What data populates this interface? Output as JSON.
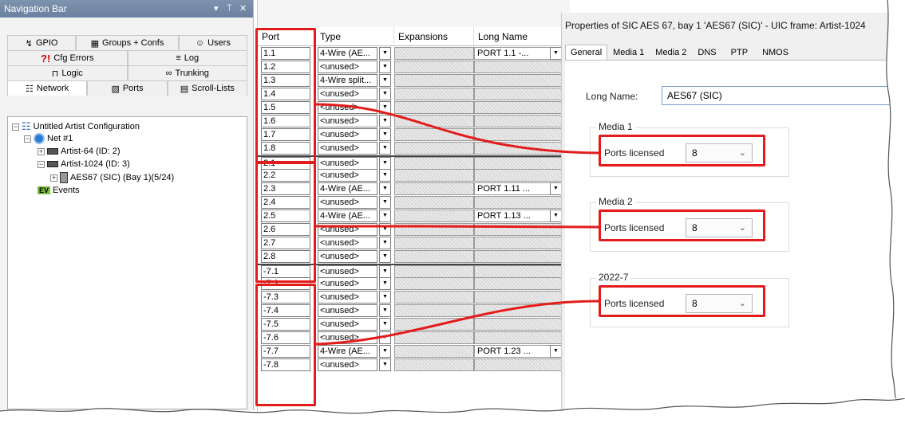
{
  "nav": {
    "title": "Navigation Bar",
    "controls": [
      "▾",
      "⍑",
      "✕"
    ],
    "tabs_row1": [
      {
        "label": "GPIO",
        "icon": "gpio-icon"
      },
      {
        "label": "Groups + Confs",
        "icon": "groups-icon"
      },
      {
        "label": "Users",
        "icon": "users-icon"
      }
    ],
    "tabs_row2": [
      {
        "label": "Cfg Errors",
        "icon": "error-icon"
      },
      {
        "label": "Log",
        "icon": "log-icon"
      }
    ],
    "tabs_row3": [
      {
        "label": "Logic",
        "icon": "logic-icon"
      },
      {
        "label": "Trunking",
        "icon": "trunking-icon"
      }
    ],
    "tabs_row4": [
      {
        "label": "Network",
        "icon": "network-icon"
      },
      {
        "label": "Ports",
        "icon": "ports-icon"
      },
      {
        "label": "Scroll-Lists",
        "icon": "scroll-lists-icon"
      }
    ],
    "tree": {
      "root": "Untitled Artist Configuration",
      "net": "Net #1",
      "node1": "Artist-64 (ID: 2)",
      "node2": "Artist-1024 (ID: 3)",
      "card": "AES67 (SIC) (Bay  1)(5/24)",
      "events": "Events",
      "events_badge": "EV"
    }
  },
  "grid": {
    "headers": [
      "Port",
      "Type",
      "Expansions",
      "Long Name"
    ],
    "rows": [
      {
        "port": "1.1",
        "type": "4-Wire (AE...",
        "long_name": "PORT 1.1 -..."
      },
      {
        "port": "1.2",
        "type": "<unused>",
        "long_name": ""
      },
      {
        "port": "1.3",
        "type": "4-Wire split...",
        "long_name": ""
      },
      {
        "port": "1.4",
        "type": "<unused>",
        "long_name": ""
      },
      {
        "port": "1.5",
        "type": "<unused>",
        "long_name": ""
      },
      {
        "port": "1.6",
        "type": "<unused>",
        "long_name": ""
      },
      {
        "port": "1.7",
        "type": "<unused>",
        "long_name": ""
      },
      {
        "port": "1.8",
        "type": "<unused>",
        "long_name": ""
      },
      {
        "port": "2.1",
        "type": "<unused>",
        "long_name": ""
      },
      {
        "port": "2.2",
        "type": "<unused>",
        "long_name": ""
      },
      {
        "port": "2.3",
        "type": "4-Wire (AE...",
        "long_name": "PORT 1.11 ..."
      },
      {
        "port": "2.4",
        "type": "<unused>",
        "long_name": ""
      },
      {
        "port": "2.5",
        "type": "4-Wire (AE...",
        "long_name": "PORT 1.13 ..."
      },
      {
        "port": "2.6",
        "type": "<unused>",
        "long_name": ""
      },
      {
        "port": "2.7",
        "type": "<unused>",
        "long_name": ""
      },
      {
        "port": "2.8",
        "type": "<unused>",
        "long_name": ""
      },
      {
        "port": "-7.1",
        "type": "<unused>",
        "long_name": ""
      },
      {
        "port": "-7.2",
        "type": "<unused>",
        "long_name": ""
      },
      {
        "port": "-7.3",
        "type": "<unused>",
        "long_name": ""
      },
      {
        "port": "-7.4",
        "type": "<unused>",
        "long_name": ""
      },
      {
        "port": "-7.5",
        "type": "<unused>",
        "long_name": ""
      },
      {
        "port": "-7.6",
        "type": "<unused>",
        "long_name": ""
      },
      {
        "port": "-7.7",
        "type": "4-Wire (AE...",
        "long_name": "PORT 1.23 ..."
      },
      {
        "port": "-7.8",
        "type": "<unused>",
        "long_name": ""
      }
    ]
  },
  "props": {
    "title": "Properties of SIC AES 67, bay 1 'AES67 (SIC)' - UIC frame: Artist-1024",
    "tabs": [
      "General",
      "Media 1",
      "Media 2",
      "DNS",
      "PTP",
      "NMOS"
    ],
    "long_name_label": "Long Name:",
    "long_name_value": "AES67 (SIC)",
    "groups": [
      {
        "title": "Media 1",
        "field_label": "Ports licensed",
        "value": "8"
      },
      {
        "title": "Media 2",
        "field_label": "Ports licensed",
        "value": "8"
      },
      {
        "title": "2022-7",
        "field_label": "Ports licensed",
        "value": "8"
      }
    ]
  },
  "colors": {
    "highlight": "#e31b1b",
    "title_bar": "#6f86a4"
  }
}
